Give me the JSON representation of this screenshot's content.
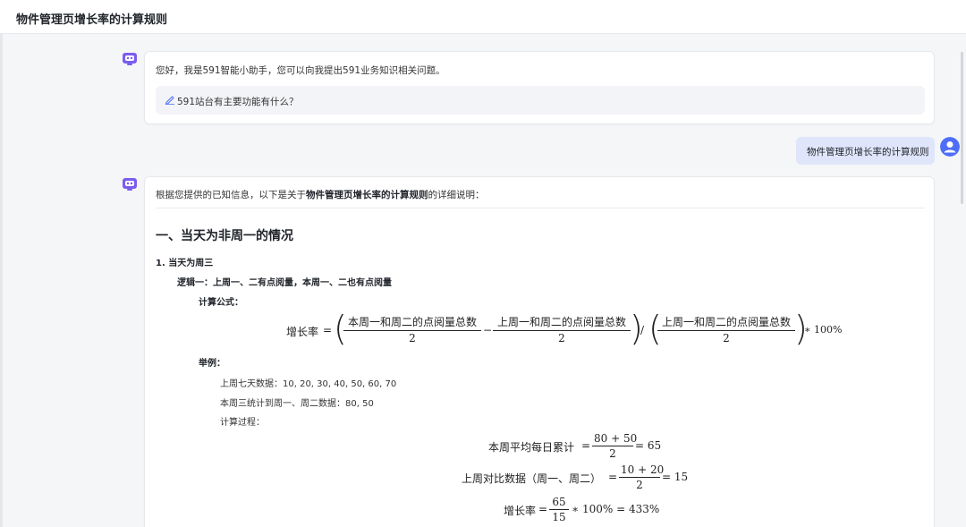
{
  "header": {
    "title": "物件管理页增长率的计算规则"
  },
  "greeting_message": {
    "text": "您好，我是591智能小助手，您可以向我提出591业务知识相关问题。",
    "suggestion": "591站台有主要功能有什么？"
  },
  "user_message": {
    "text": "物件管理页增长率的计算规则"
  },
  "answer": {
    "intro_prefix": "根据您提供的已知信息，以下是关于",
    "intro_bold": "物件管理页增长率的计算规则",
    "intro_suffix": "的详细说明：",
    "heading": "一、当天为非周一的情况",
    "item1": "1. 当天为周三",
    "logic1": "逻辑一：上周一、二有点阅量，本周一、二也有点阅量",
    "formula_label": "计算公式：",
    "formula": {
      "lhs": "增长率",
      "eq": "=",
      "num1": "本周一和周二的点阅量总数",
      "den1": "2",
      "minus": "−",
      "num2": "上周一和周二的点阅量总数",
      "den2": "2",
      "slash": "/",
      "num3": "上周一和周二的点阅量总数",
      "den3": "2",
      "tail": "∗ 100%"
    },
    "example_label": "举例：",
    "example_lines": [
      "上周七天数据：10, 20, 30, 40, 50, 60, 70",
      "本周三统计到周一、周二数据：80, 50",
      "计算过程："
    ],
    "calc1": {
      "lhs": "本周平均每日累计",
      "eq": "=",
      "num": "80 + 50",
      "den": "2",
      "result": "= 65"
    },
    "calc2": {
      "lhs": "上周对比数据（周一、周二）",
      "eq": "=",
      "num": "10 + 20",
      "den": "2",
      "result": "= 15"
    },
    "calc3": {
      "lhs": "增长率",
      "eq": "=",
      "num": "65",
      "den": "15",
      "result": "∗ 100% = 433%"
    }
  }
}
